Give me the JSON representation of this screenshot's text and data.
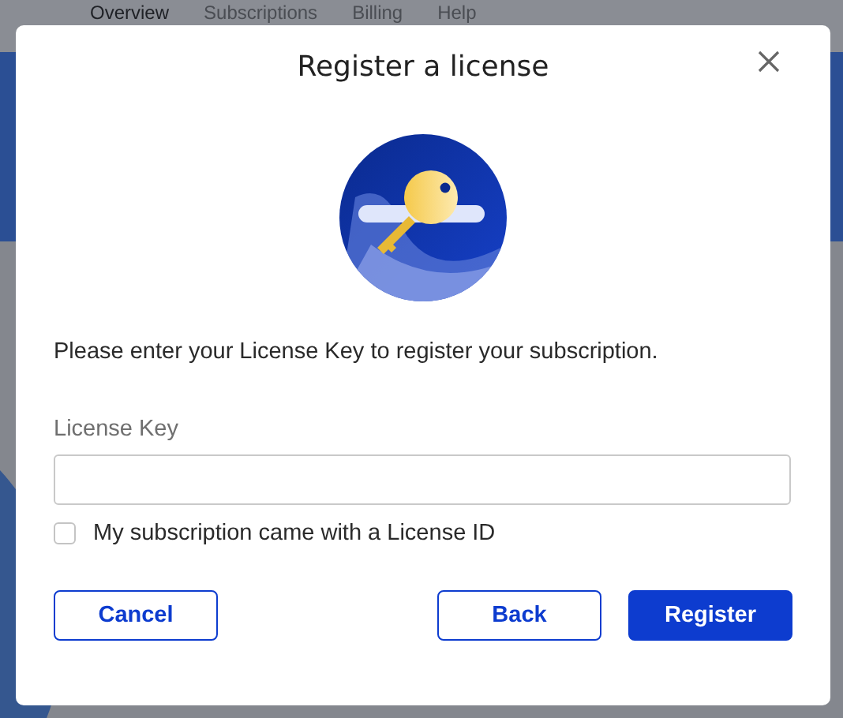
{
  "background_nav": [
    {
      "label": "Overview",
      "selected": true
    },
    {
      "label": "Subscriptions",
      "selected": false
    },
    {
      "label": "Billing",
      "selected": false
    },
    {
      "label": "Help",
      "selected": false
    }
  ],
  "dialog": {
    "title": "Register a license",
    "message": "Please enter your License Key to register your subscription.",
    "field": {
      "label": "License Key"
    },
    "checkbox": {
      "label": "My subscription came with a License ID",
      "checked": false
    },
    "buttons": [
      {
        "label": "Cancel",
        "kind": "outline"
      },
      {
        "label": "Back",
        "kind": "outline"
      },
      {
        "label": "Register",
        "kind": "primary"
      }
    ]
  }
}
